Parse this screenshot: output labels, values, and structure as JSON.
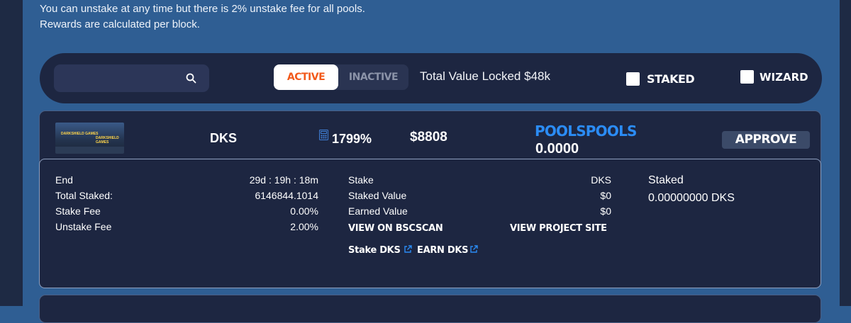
{
  "notice": {
    "line1": "You can unstake at any time but there is 2% unstake fee for all pools.",
    "line2": "Rewards are calculated per block."
  },
  "filter": {
    "search_placeholder": "",
    "active_label": "ACTIVE",
    "inactive_label": "INACTIVE",
    "tvl_text": "Total Value Locked $48k",
    "staked_label": "STAKED",
    "staked_checked": false,
    "wizard_label": "WIZARD",
    "wizard_checked": false
  },
  "pool": {
    "logo_text_left": "DARKSHIELD GAMES",
    "logo_text_right": "DARKSHIELD GAMES",
    "name": "DKS",
    "apr": "1799%",
    "tvl": "$8808",
    "earned_label": "POOLSPOOLS",
    "earned_value": "0.0000",
    "approve_label": "APPROVE",
    "details": {
      "end_label": "End",
      "end_value": "29d : 19h : 18m",
      "total_staked_label": "Total Staked:",
      "total_staked_value": "6146844.1014",
      "stake_fee_label": "Stake Fee",
      "stake_fee_value": "0.00%",
      "unstake_fee_label": "Unstake Fee",
      "unstake_fee_value": "2.00%",
      "stake_label": "Stake",
      "stake_value": "DKS",
      "staked_value_label": "Staked Value",
      "staked_value_value": "$0",
      "earned_value_label": "Earned Value",
      "earned_value_value": "$0",
      "view_bscscan": "VIEW ON BSCSCAN",
      "view_project": "VIEW PROJECT SITE",
      "stake_link": "Stake DKS",
      "earn_link": "EARN DKS",
      "staked_heading": "Staked",
      "staked_amount": "0.00000000 DKS"
    }
  },
  "colors": {
    "page_bg": "#2f5e93",
    "panel_bg": "#1d2641",
    "accent_orange": "#f25a1c",
    "accent_blue": "#2b8cf5"
  }
}
